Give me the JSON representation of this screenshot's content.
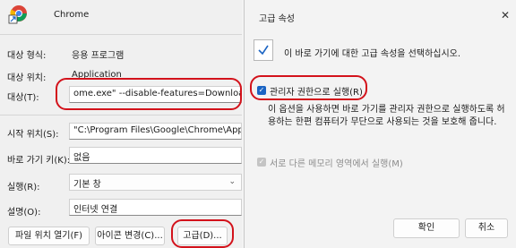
{
  "properties": {
    "app_name": "Chrome",
    "target_type": {
      "label": "대상 형식:",
      "value": "응용 프로그램"
    },
    "target_location": {
      "label": "대상 위치:",
      "value": "Application"
    },
    "target": {
      "label": "대상(T):",
      "value": "ome.exe\" --disable-features=DownloadBubble"
    },
    "start_in": {
      "label": "시작 위치(S):",
      "value": "\"C:\\Program Files\\Google\\Chrome\\Applicati"
    },
    "shortcut_key": {
      "label": "바로 가기 키(K):",
      "value": "없음"
    },
    "run": {
      "label": "실행(R):",
      "value": "기본 창"
    },
    "comment": {
      "label": "설명(O):",
      "value": "인터넷 연결"
    },
    "buttons": {
      "open_location": "파일 위치 열기(F)",
      "change_icon": "아이콘 변경(C)...",
      "advanced": "고급(D)..."
    }
  },
  "advanced_dialog": {
    "title": "고급 속성",
    "close": "✕",
    "description": "이 바로 가기에 대한 고급 속성을 선택하십시오.",
    "run_as_admin": {
      "label": "관리자 권한으로 실행(R)",
      "checked": true
    },
    "explanation": "이 옵션을 사용하면 바로 가기를 관리자 권한으로 실행하도록 허용하는 한편 컴퓨터가 무단으로 사용되는 것을 보호해 줍니다.",
    "separate_memory": {
      "label": "서로 다른 메모리 영역에서 실행(M)",
      "checked": true,
      "disabled": true
    },
    "ok": "확인",
    "cancel": "취소"
  },
  "colors": {
    "highlight": "#d3121b",
    "checkbox": "#1b64c3"
  }
}
